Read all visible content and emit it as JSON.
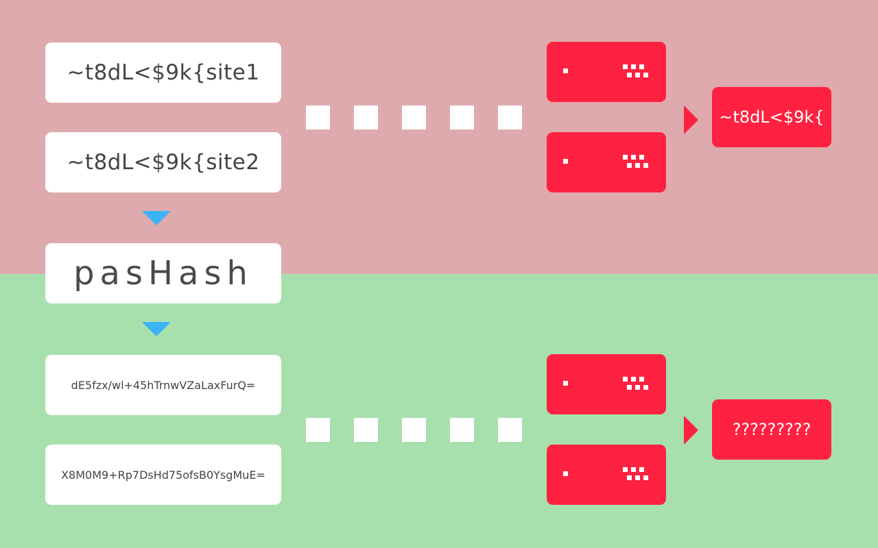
{
  "top": {
    "password_site1": "~t8dL<$9k{site1",
    "password_site2": "~t8dL<$9k{site2",
    "leaked_result": "~t8dL<$9k{"
  },
  "app": {
    "name": "pasHash"
  },
  "bottom": {
    "hash_site1": "dE5fzx/wl+45hTrnwVZaLaxFurQ=",
    "hash_site2": "X8M0M9+Rp7DsHd75ofsB0YsgMuE=",
    "unknown_result": "?????????"
  },
  "colors": {
    "unsafe_background": "#dfaaad",
    "safe_background": "#a8e0ad",
    "server": "#ff2141",
    "arrow": "#3bb3f5"
  }
}
